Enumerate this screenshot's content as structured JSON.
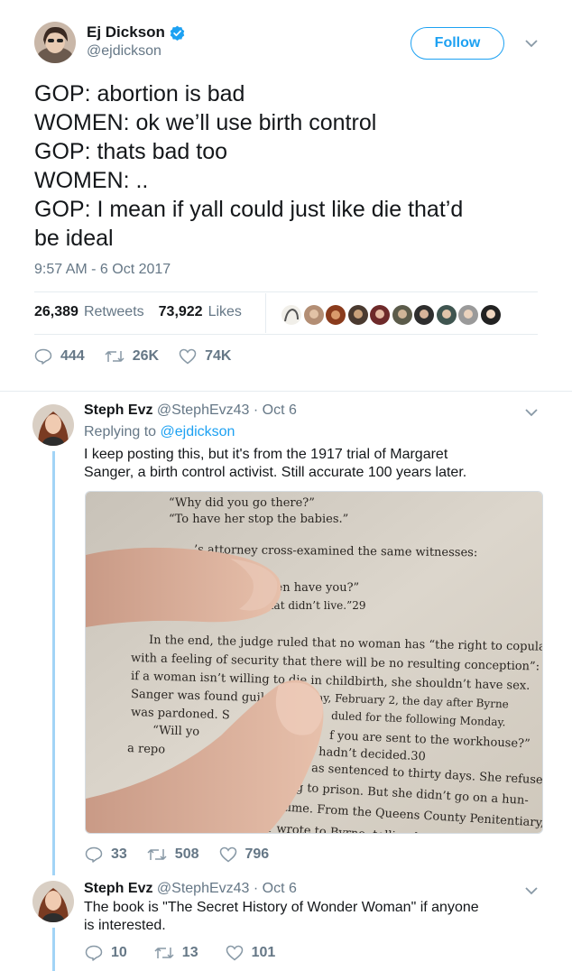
{
  "main_tweet": {
    "name": "Ej Dickson",
    "handle": "@ejdickson",
    "follow_label": "Follow",
    "lines": [
      "GOP: abortion is bad",
      "WOMEN: ok we’ll use birth control",
      "GOP: thats bad too",
      "WOMEN: ..",
      "GOP: I mean if yall could just like die that’d",
      "be ideal"
    ],
    "timestamp": "9:57 AM - 6 Oct 2017",
    "retweets_count": "26,389",
    "retweets_label": "Retweets",
    "likes_count": "73,922",
    "likes_label": "Likes",
    "replies": "444",
    "retweets_short": "26K",
    "likes_short": "74K"
  },
  "reply1": {
    "name": "Steph Evz",
    "handle_date": "@StephEvz43 · Oct 6",
    "replying_prefix": "Replying to",
    "replying_to": "@ejdickson",
    "text_line1": "I keep posting this, but it's from the 1917 trial of Margaret",
    "text_line2": "Sanger, a birth control activist. Still accurate 100 years later.",
    "replies": "33",
    "retweets": "508",
    "likes": "796"
  },
  "reply2": {
    "name": "Steph Evz",
    "handle_date": "@StephEvz43 · Oct 6",
    "text_line1": "The book is \"The Secret History of Wonder Woman\" if anyone",
    "text_line2": "is interested.",
    "replies": "10",
    "retweets": "13",
    "likes": "101"
  },
  "photo_text": {
    "l1": "“Why did you go there?”",
    "l2": "“To have her stop the babies.”",
    "l3": "’s attorney cross-examined the same witnesses:",
    "l4": "dren have you?”",
    "l5": "that didn’t live.”29",
    "l6": "In the end, the judge ruled that no woman has “the right to copulate",
    "l7": "with a feeling of security that there will be no resulting conception”:",
    "l8": "if a woman isn’t willing to die in childbirth, she shouldn’t have sex.",
    "l9a": "Sanger was found guil",
    "l9b": "ay, February 2, the day after Byrne",
    "l10a": "was pardoned. S",
    "l10b": "duled for the following Monday.",
    "l11a": "“Will yo",
    "l11b": "f you are sent to the workhouse?”",
    "l12a": "a repo",
    "l12b": "hadn’t decided.30",
    "l13": "as sentenced to thirty days. She refused",
    "l14": "going to prison. But she didn’t go on a hun-",
    "l15": "her time. From the Queens County Penitentiary,",
    "l16": "Sanger wrote to Byrne, telling her sister that she"
  },
  "colors": {
    "accent": "#1da1f2",
    "muted": "#657786",
    "thread": "#a2d4f6",
    "verified": "#1da1f2"
  }
}
